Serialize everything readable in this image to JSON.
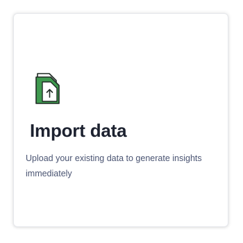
{
  "card": {
    "icon": "file-upload-icon",
    "accent_color": "#3f9a4f",
    "title": "Import data",
    "description": "Upload your existing data to generate insights immediately"
  }
}
